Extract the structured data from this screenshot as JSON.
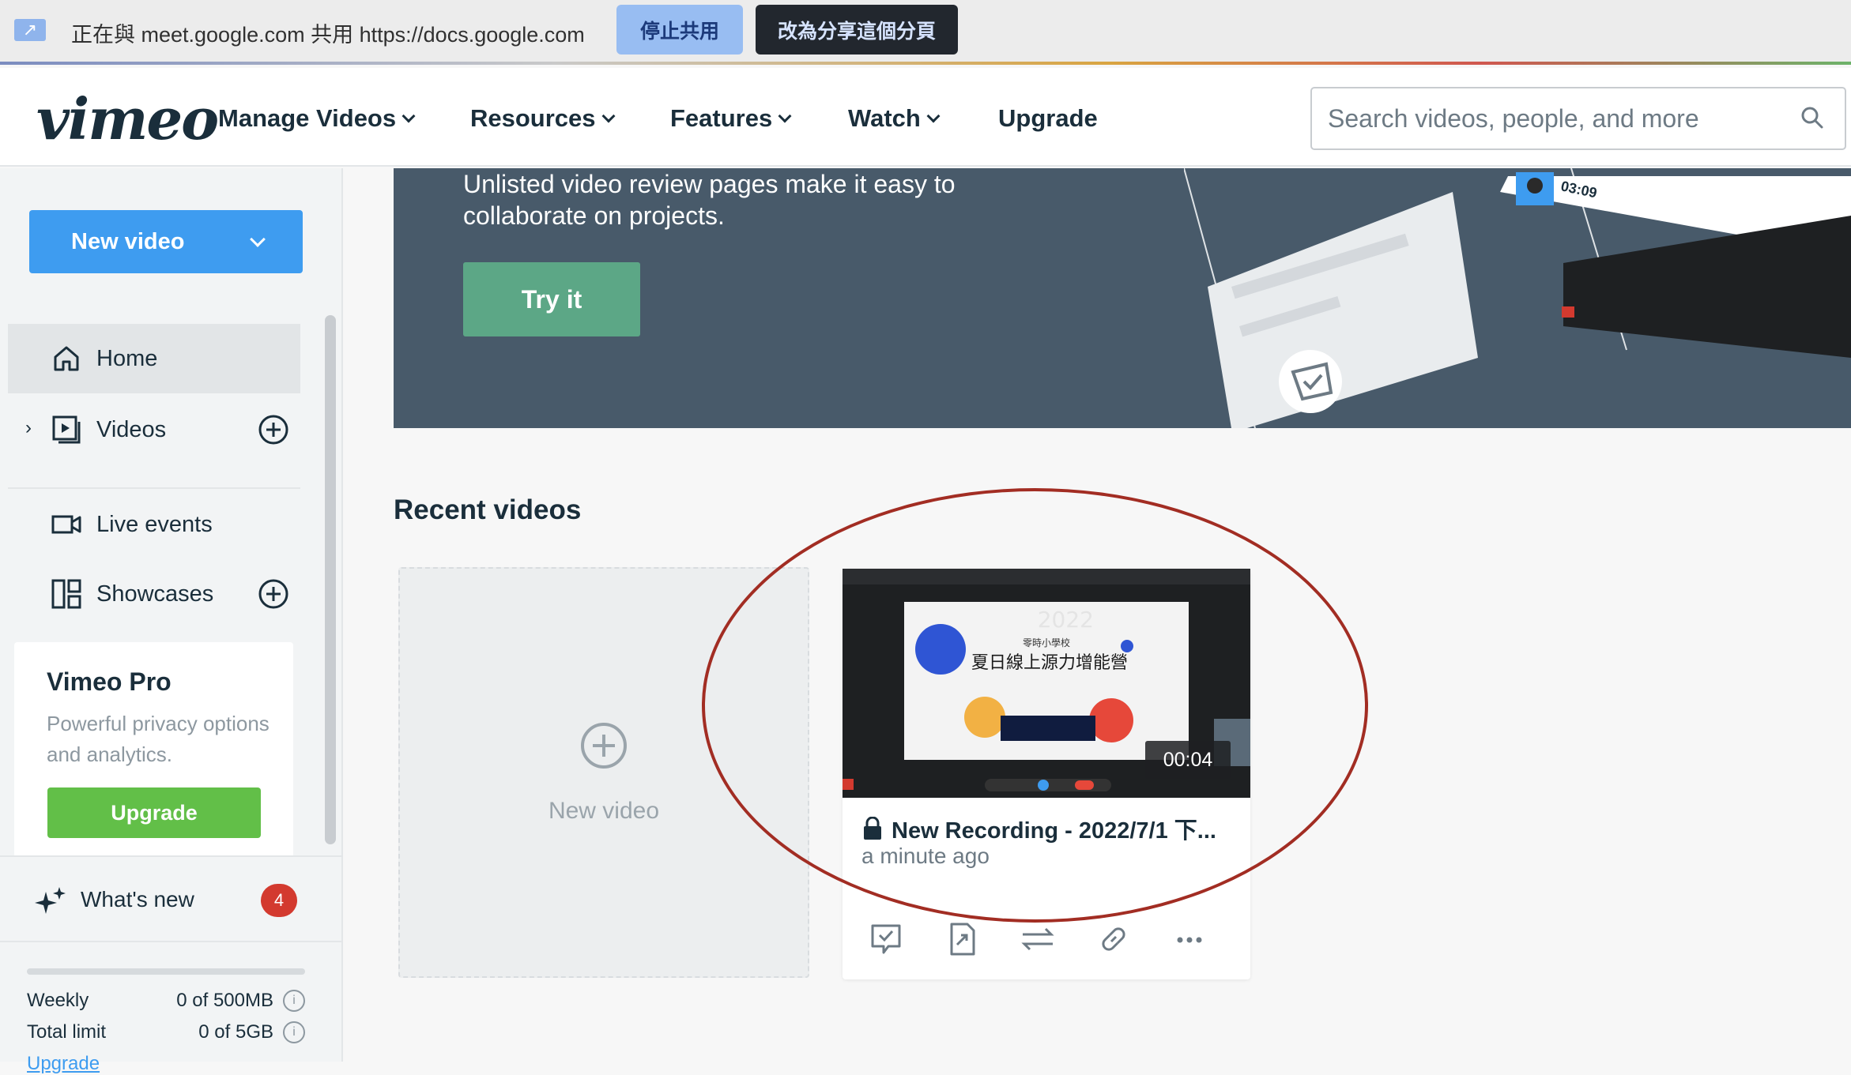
{
  "share_bar": {
    "message": "正在與 meet.google.com 共用 https://docs.google.com",
    "stop_label": "停止共用",
    "switch_label": "改為分享這個分頁"
  },
  "nav": {
    "logo": "vimeo",
    "items": [
      {
        "label": "Manage Videos"
      },
      {
        "label": "Resources"
      },
      {
        "label": "Features"
      },
      {
        "label": "Watch"
      },
      {
        "label": "Upgrade"
      }
    ],
    "search_placeholder": "Search videos, people, and more"
  },
  "sidebar": {
    "new_video_label": "New video",
    "items": [
      {
        "label": "Home",
        "icon": "home-icon"
      },
      {
        "label": "Videos",
        "icon": "videos-icon"
      },
      {
        "label": "Live events",
        "icon": "camera-icon"
      },
      {
        "label": "Showcases",
        "icon": "showcase-icon"
      }
    ],
    "pro": {
      "title": "Vimeo Pro",
      "description": "Powerful privacy options and analytics.",
      "button": "Upgrade"
    },
    "whats_new": {
      "label": "What's new",
      "count": "4"
    },
    "storage": {
      "weekly_label": "Weekly",
      "weekly_value": "0 of 500MB",
      "total_label": "Total limit",
      "total_value": "0 of 5GB",
      "upgrade_link": "Upgrade"
    }
  },
  "banner": {
    "text": "Unlisted video review pages make it easy to collaborate on projects.",
    "button": "Try it",
    "art_timestamp": "03:09"
  },
  "recent": {
    "title": "Recent videos",
    "new_video_label": "New video",
    "video": {
      "title": "New Recording - 2022/7/1 下...",
      "time": "a minute ago",
      "duration": "00:04",
      "slide_title": "夏日線上源力增能營",
      "slide_school": "零時小學校",
      "slide_year": "2022"
    }
  },
  "colors": {
    "brand_blue": "#3e9cf0",
    "upgrade_green": "#62bf48",
    "banner_bg": "#485a6a",
    "try_green": "#5ca786",
    "annotation_red": "#a22d23",
    "badge_red": "#d33a2f"
  }
}
